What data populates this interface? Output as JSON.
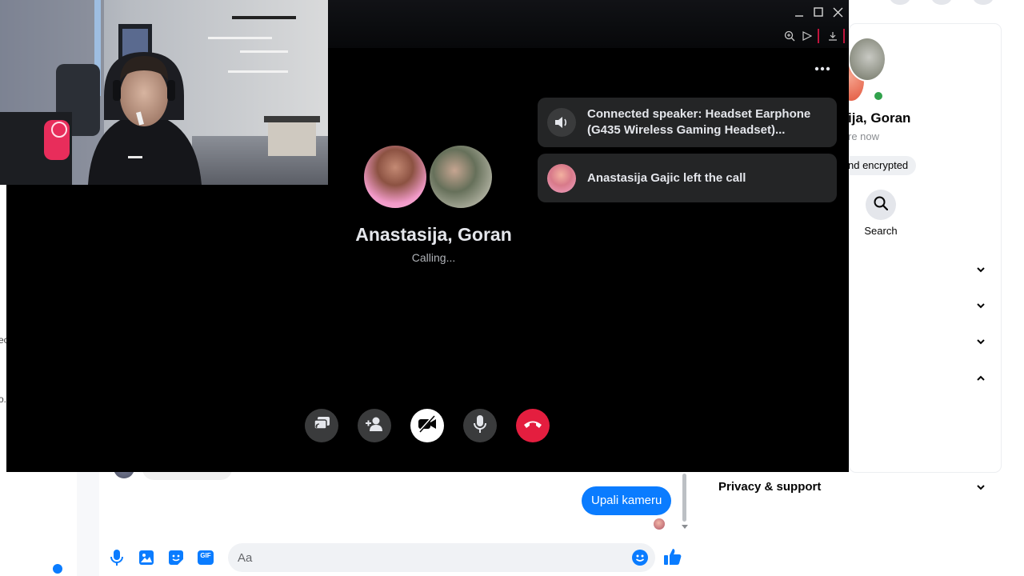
{
  "background": {
    "left_rail": {
      "cut_text_1": "ec",
      "cut_text_2": "o."
    },
    "chat": {
      "sent_message": "Upali kameru",
      "composer_placeholder": "Aa",
      "composer_icons": [
        "mic-icon",
        "image-icon",
        "sticker-icon",
        "gif-icon",
        "emoji-icon",
        "like-icon"
      ],
      "gif_label": "GIF"
    },
    "info_pane": {
      "name": "ija, Goran",
      "status": "re now",
      "encryption_badge": "nd encrypted",
      "search_label": "Search",
      "sections": [
        "collapsed",
        "collapsed",
        "collapsed",
        "expanded"
      ],
      "privacy_label": "Privacy & support",
      "online_color": "#31a24c"
    }
  },
  "call": {
    "toasts": [
      {
        "icon": "speaker-icon",
        "text": "Connected speaker: Headset Earphone (G435 Wireless Gaming Headset)..."
      },
      {
        "icon": "avatar",
        "text": "Anastasija Gajic left the call"
      }
    ],
    "caller_name": "Anastasija, Goran",
    "status": "Calling...",
    "controls": [
      {
        "name": "share-screen-button",
        "icon": "share-screen-icon"
      },
      {
        "name": "add-person-button",
        "icon": "add-person-icon"
      },
      {
        "name": "camera-off-button",
        "icon": "camera-off-icon"
      },
      {
        "name": "microphone-button",
        "icon": "microphone-icon"
      },
      {
        "name": "end-call-button",
        "icon": "end-call-icon"
      }
    ],
    "end_call_color": "#e41e3f",
    "window_controls": [
      "minimize-icon",
      "maximize-icon",
      "close-icon"
    ]
  }
}
